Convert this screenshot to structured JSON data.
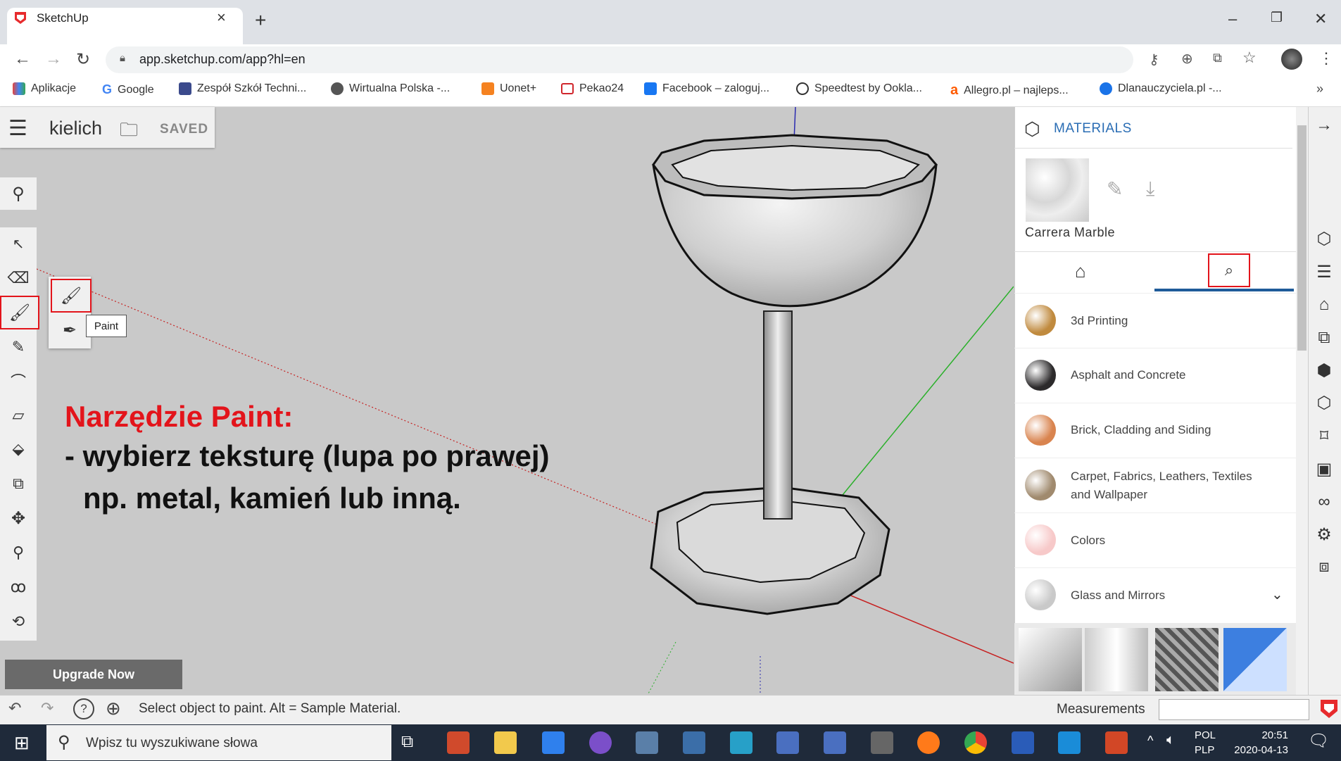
{
  "browser": {
    "tab_title": "SketchUp",
    "tab_close": "×",
    "new_tab": "+",
    "url": "app.sketchup.com/app?hl=en",
    "window_min": "–",
    "window_max": "❐",
    "window_close": "✕",
    "bookmarks": [
      {
        "label": "Aplikacje",
        "color": "#e8453c"
      },
      {
        "label": "Google",
        "color": "#4285f4"
      },
      {
        "label": "Zespół Szkół Techni...",
        "color": "#3b4a8c"
      },
      {
        "label": "Wirtualna Polska -...",
        "color": "#555555"
      },
      {
        "label": "Uonet+",
        "color": "#f58220"
      },
      {
        "label": "Pekao24",
        "color": "#d0262c"
      },
      {
        "label": "Facebook – zaloguj...",
        "color": "#1877f2"
      },
      {
        "label": "Speedtest by Ookla...",
        "color": "#333333"
      },
      {
        "label": "Allegro.pl – najleps...",
        "color": "#ff5a00"
      },
      {
        "label": "Dlanauczyciela.pl -...",
        "color": "#1a73e8"
      }
    ],
    "bookmarks_more": "»"
  },
  "app": {
    "doc_name": "kielich",
    "saved_label": "SAVED",
    "tooltip": "Paint",
    "upgrade_label": "Upgrade Now"
  },
  "annotation": {
    "title": "Narzędzie Paint:",
    "line1": "- wybierz teksturę (lupa po prawej)",
    "line2": "np. metal, kamień lub inną."
  },
  "materials": {
    "title": "MATERIALS",
    "current_name": "Carrera Marble",
    "categories": [
      {
        "label": "3d Printing",
        "color": "#c08a3e"
      },
      {
        "label": "Asphalt and Concrete",
        "color": "#2c2a2b"
      },
      {
        "label": "Brick, Cladding and Siding",
        "color": "#d9844f"
      },
      {
        "label": "Carpet, Fabrics, Leathers, Textiles and Wallpaper",
        "color": "#a08a6e"
      },
      {
        "label": "Colors",
        "color": "#f7c9c9"
      },
      {
        "label": "Glass and Mirrors",
        "color": "#c9c9c9"
      }
    ]
  },
  "status": {
    "hint": "Select object to paint. Alt = Sample Material.",
    "measurements_label": "Measurements"
  },
  "taskbar": {
    "search_placeholder": "Wpisz tu wyszukiwane słowa",
    "lang_top": "POL",
    "lang_bottom": "PLP",
    "time": "20:51",
    "date": "2020-04-13"
  }
}
